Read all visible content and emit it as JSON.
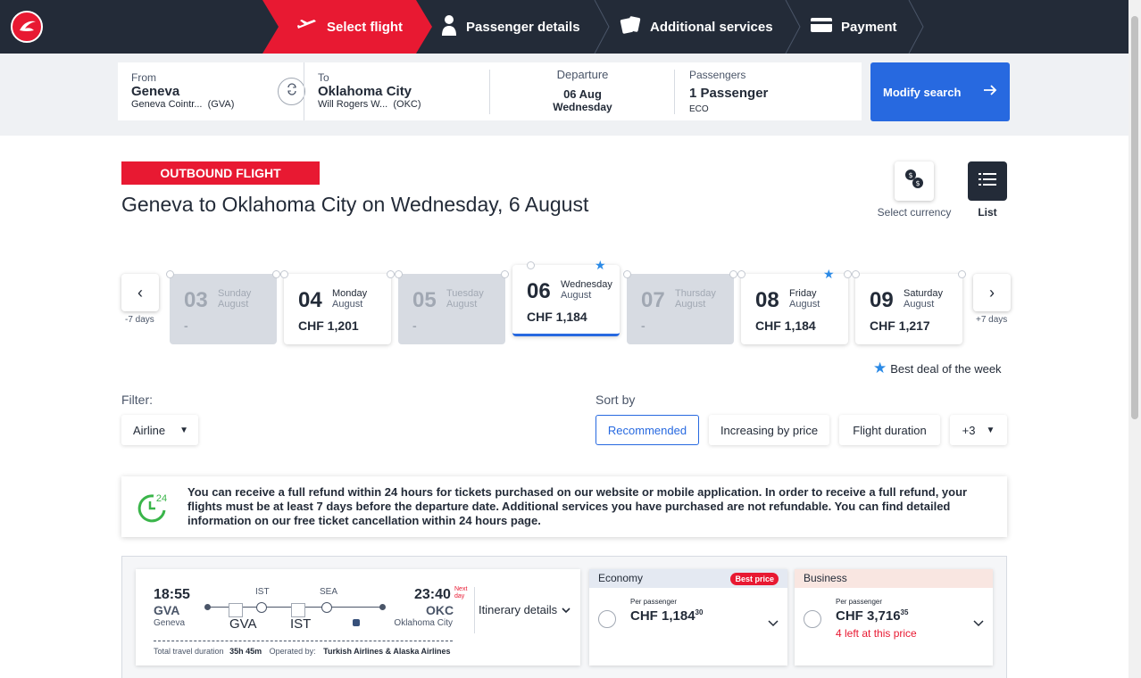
{
  "header": {
    "steps": [
      {
        "label": "Select flight",
        "icon": "plane-icon"
      },
      {
        "label": "Passenger details",
        "icon": "person-icon"
      },
      {
        "label": "Additional services",
        "icon": "cards-icon"
      },
      {
        "label": "Payment",
        "icon": "credit-card-icon"
      }
    ]
  },
  "search": {
    "from_label": "From",
    "from_city": "Geneva",
    "from_airport": "Geneva Cointr...",
    "from_code": "(GVA)",
    "to_label": "To",
    "to_city": "Oklahoma City",
    "to_airport": "Will Rogers W...",
    "to_code": "(OKC)",
    "departure_label": "Departure",
    "departure_date": "06 Aug",
    "departure_day": "Wednesday",
    "passengers_label": "Passengers",
    "passengers_value": "1 Passenger",
    "cabin": "ECO",
    "modify_label": "Modify search"
  },
  "main": {
    "outbound_tag": "OUTBOUND FLIGHT",
    "title": "Geneva to Oklahoma City on Wednesday, 6 August",
    "currency_label": "Select currency",
    "list_label": "List"
  },
  "dates": {
    "prev_label": "-7 days",
    "next_label": "+7 days",
    "days": [
      {
        "num": "03",
        "weekday": "Sunday",
        "month": "August",
        "price": "-",
        "disabled": true
      },
      {
        "num": "04",
        "weekday": "Monday",
        "month": "August",
        "price": "CHF 1,201",
        "disabled": false
      },
      {
        "num": "05",
        "weekday": "Tuesday",
        "month": "August",
        "price": "-",
        "disabled": true
      },
      {
        "num": "06",
        "weekday": "Wednesday",
        "month": "August",
        "price": "CHF 1,184",
        "selected": true,
        "best": true
      },
      {
        "num": "07",
        "weekday": "Thursday",
        "month": "August",
        "price": "-",
        "disabled": true
      },
      {
        "num": "08",
        "weekday": "Friday",
        "month": "August",
        "price": "CHF 1,184",
        "best": true
      },
      {
        "num": "09",
        "weekday": "Saturday",
        "month": "August",
        "price": "CHF 1,217"
      }
    ],
    "best_deal_label": "Best deal of the week"
  },
  "filter": {
    "label": "Filter:",
    "airline_label": "Airline"
  },
  "sort": {
    "label": "Sort by",
    "options": [
      "Recommended",
      "Increasing by price",
      "Flight duration",
      "+3"
    ]
  },
  "notice": {
    "badge": "24",
    "text": "You can receive a full refund within 24 hours for tickets purchased on our website or mobile application. In order to receive a full refund, your flights must be at least 7 days before the departure date. Additional services you have purchased are not refundable. You can find detailed information on our free ticket cancellation within 24 hours page."
  },
  "flight": {
    "dep_time": "18:55",
    "dep_code": "GVA",
    "dep_city": "Geneva",
    "arr_time": "23:40",
    "arr_code": "OKC",
    "arr_city": "Oklahoma City",
    "next_day": "Next day",
    "stop1": "IST",
    "stop2": "SEA",
    "img1": "GVA",
    "img2": "IST",
    "itinerary_label": "Itinerary details",
    "duration_label": "Total travel duration",
    "duration": "35h 45m",
    "operated_label": "Operated by:",
    "operated": "Turkish Airlines & Alaska Airlines"
  },
  "fares": {
    "economy": {
      "label": "Economy",
      "badge": "Best price",
      "per": "Per passenger",
      "price": "CHF 1,184",
      "cents": "30",
      "color": "#e4e9f2"
    },
    "business": {
      "label": "Business",
      "per": "Per passenger",
      "price": "CHF 3,716",
      "cents": "35",
      "left": "4 left at this price",
      "color": "#f9e6e1"
    }
  },
  "colors": {
    "brand_red": "#e81932",
    "nav_dark": "#232b38",
    "accent_blue": "#2769e0"
  }
}
